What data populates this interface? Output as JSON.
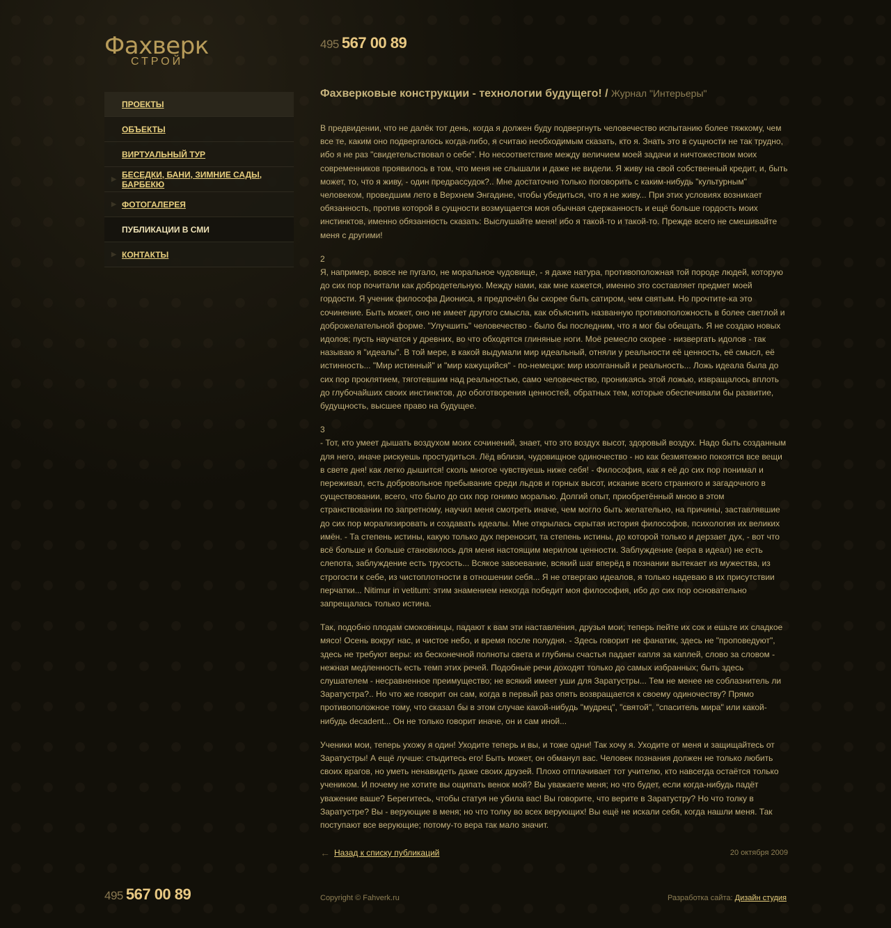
{
  "logo": {
    "main": "Фахверк",
    "sub": "СТРОЙ"
  },
  "phone": {
    "code": "495",
    "number": "567 00 89"
  },
  "nav": [
    {
      "label": "ПРОЕКТЫ"
    },
    {
      "label": "ОБЪЕКТЫ"
    },
    {
      "label": "ВИРТУАЛЬНЫЙ ТУР"
    },
    {
      "label": "БЕСЕДКИ, БАНИ, ЗИМНИЕ САДЫ, БАРБЕКЮ"
    },
    {
      "label": "ФОТОГАЛЕРЕЯ"
    },
    {
      "label": "ПУБЛИКАЦИИ В СМИ"
    },
    {
      "label": "КОНТАКТЫ"
    }
  ],
  "article": {
    "title": "Фахверковые конструкции - технологии будущего!",
    "separator": " / ",
    "source": "Журнал \"Интерьеры\"",
    "paragraphs": [
      "В предвидении, что не далёк тот день, когда я должен буду подвергнуть человечество испытанию более тяжкому, чем все те, каким оно подвергалось когда-либо, я считаю необходимым сказать, кто я. Знать это в сущности не так трудно, ибо я не раз \"свидетельствовал о себе\". Но несоответствие между величием моей задачи и ничтожеством моих современников проявилось в том, что меня не слышали и даже не видели. Я живу на свой собственный кредит, и, быть может, то, что я живу, - один предрассудок?.. Мне достаточно только поговорить с каким-нибудь \"культурным\" человеком, проведшим лето в Верхнем Энгадине, чтобы убедиться, что я не живу... При этих условиях возникает обязанность, против которой в сущности возмущается моя обычная сдержанность и ещё больше гордость моих инстинктов, именно обязанность сказать: Выслушайте меня! ибо я такой-то и такой-то. Прежде всего не смешивайте меня с другими!",
      "2\nЯ, например, вовсе не пугало, не моральное чудовище, - я даже натура, противоположная той породе людей, которую до сих пор почитали как добродетельную. Между нами, как мне кажется, именно это составляет предмет моей гордости. Я ученик философа Диониса, я предпочёл бы скорее быть сатиром, чем святым. Но прочтите-ка это сочинение. Быть может, оно не имеет другого смысла, как объяснить названную противоположность в более светлой и доброжелательной форме. \"Улучшить\" человечество - было бы последним, что я мог бы обещать. Я не создаю новых идолов; пусть научатся у древних, во что обходятся глиняные ноги. Моё ремесло скорее - низвергать идолов - так называю я \"идеалы\". В той мере, в какой выдумали мир идеальный, отняли у реальности её ценность, её смысл, её истинность... \"Мир истинный\" и \"мир кажущийся\" - по-немецки: мир изолганный и реальность... Ложь идеала была до сих пор проклятием, тяготевшим над реальностью, само человечество, проникаясь этой ложью, извращалось вплоть до глубочайших своих инстинктов, до обоготворения ценностей, обратных тем, которые обеспечивали бы развитие, будущность, высшее право на будущее.",
      "3\n- Тот, кто умеет дышать воздухом моих сочинений, знает, что это воздух высот, здоровый воздух. Надо быть созданным для него, иначе рискуешь простудиться. Лёд вблизи, чудовищное одиночество - но как безмятежно покоятся все вещи в свете дня! как легко дышится! сколь многое чувствуешь ниже себя! - Философия, как я её до сих пор понимал и переживал, есть добровольное пребывание среди льдов и горных высот, искание всего странного и загадочного в существовании, всего, что было до сих пор гонимо моралью. Долгий опыт, приобретённый мною в этом странствовании по запретному, научил меня смотреть иначе, чем могло быть желательно, на причины, заставлявшие до сих пор морализировать и создавать идеалы. Мне открылась скрытая история философов, психология их великих имён. - Та степень истины, какую только дух переносит, та степень истины, до которой только и дерзает дух, - вот что всё больше и больше становилось для меня настоящим мерилом ценности. Заблуждение (вера в идеал) не есть слепота, заблуждение есть трусость... Всякое завоевание, всякий шаг вперёд в познании вытекает из мужества, из строгости к себе, из чистоплотности в отношении себя... Я не отвергаю идеалов, я только надеваю в их присутствии перчатки... Nitimur in vetitum: этим знамением некогда победит моя философия, ибо до сих пор основательно запрещалась только истина.",
      "Так, подобно плодам смоковницы, падают к вам эти наставления, друзья мои; теперь пейте их сок и ешьте их сладкое мясо! Осень вокруг нас, и чистое небо, и время после полудня. - Здесь говорит не фанатик, здесь не \"проповедуют\", здесь не требуют веры: из бесконечной полноты света и глубины счастья падает капля за каплей, слово за словом - нежная медленность есть темп этих речей. Подобные речи доходят только до самых избранных; быть здесь слушателем - несравненное преимущество; не всякий имеет уши для Заратустры... Тем не менее не соблазнитель ли Заратустра?.. Но что же говорит он сам, когда в первый раз опять возвращается к своему одиночеству? Прямо противоположное тому, что сказал бы в этом случае какой-нибудь \"мудрец\", \"святой\", \"спаситель мира\" или какой-нибудь decadent... Он не только говорит иначе, он и сам иной...",
      "Ученики мои, теперь ухожу я один! Уходите теперь и вы, и тоже одни! Так хочу я. Уходите от меня и защищайтесь от Заратустры! А ещё лучше: стыдитесь его! Быть может, он обманул вас. Человек познания должен не только любить своих врагов, но уметь ненавидеть даже своих друзей. Плохо отплачивает тот учителю, кто навсегда остаётся только учеником. И почему не хотите вы ощипать венок мой? Вы уважаете меня; но что будет, если когда-нибудь падёт уважение ваше? Берегитесь, чтобы статуя не убила вас! Вы говорите, что верите в Заратустру? Но что толку в Заратустре? Вы - верующие в меня; но что толку во всех верующих! Вы ещё не искали себя, когда нашли меня. Так поступают все верующие; потому-то вера так мало значит."
    ],
    "back_arrow": "←",
    "back_label": "Назад к списку публикаций",
    "date": "20 октября 2009"
  },
  "footer": {
    "copyright": "Copyright © Fahverk.ru",
    "dev_label": "Разработка сайта:",
    "dev_link": "Дизайн студия"
  }
}
